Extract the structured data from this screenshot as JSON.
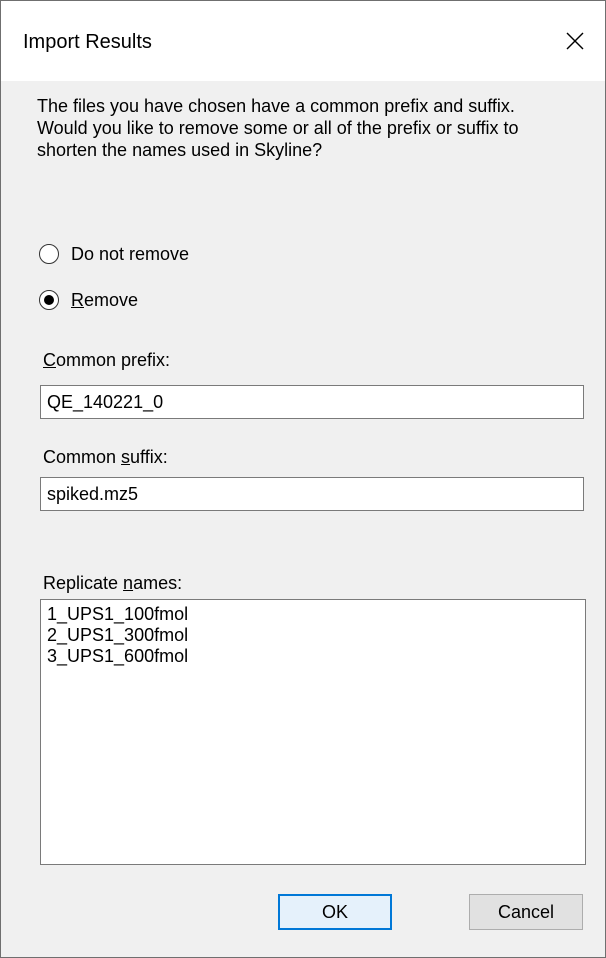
{
  "window": {
    "title": "Import Results",
    "close_icon": "close-icon"
  },
  "message": {
    "line1": "The files you have chosen have a common prefix and suffix.",
    "line2": "Would you like to remove some or all of the prefix or suffix to shorten the names used in Skyline?"
  },
  "options": {
    "do_not_remove_label": "Do not remove",
    "remove_label_underlined": "R",
    "remove_label_rest": "emove",
    "selected": "Remove"
  },
  "prefix": {
    "label_underlined": "C",
    "label_rest": "ommon prefix:",
    "value": "QE_140221_0"
  },
  "suffix": {
    "label_before": "Common ",
    "label_underlined": "s",
    "label_after": "uffix:",
    "value": "spiked.mz5"
  },
  "replicates": {
    "label_before": "Replicate ",
    "label_underlined": "n",
    "label_after": "ames:",
    "items": [
      "1_UPS1_100fmol",
      "2_UPS1_300fmol",
      "3_UPS1_600fmol"
    ]
  },
  "buttons": {
    "ok": "OK",
    "cancel": "Cancel"
  }
}
